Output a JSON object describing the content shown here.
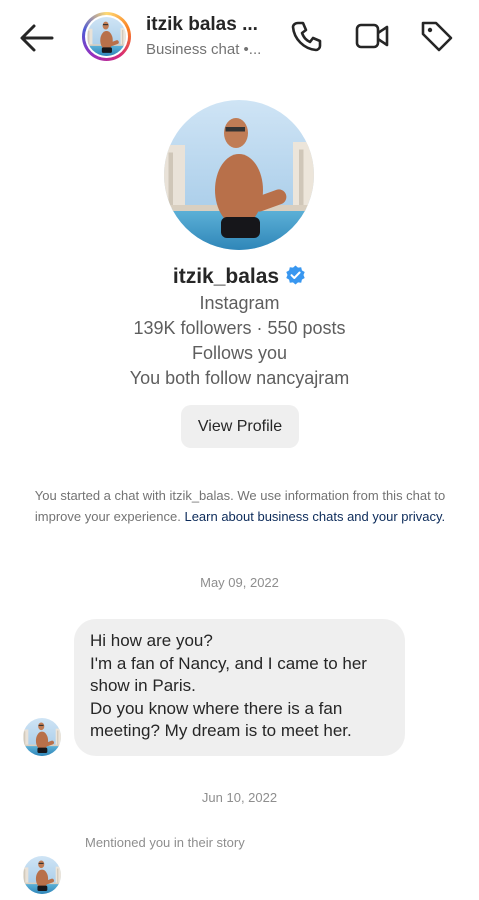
{
  "header": {
    "title": "itzik balas ...",
    "subtitle": "Business chat •...",
    "back_icon": "arrow-left-icon",
    "call_icon": "phone-icon",
    "video_icon": "video-camera-icon",
    "tag_icon": "tag-icon"
  },
  "profile": {
    "username": "itzik_balas",
    "verified_icon": "verified-badge-icon",
    "platform": "Instagram",
    "stats": "139K followers · 550 posts",
    "follows_you": "Follows you",
    "mutual": "You both follow nancyajram",
    "view_profile_label": "View Profile"
  },
  "notice": {
    "text": "You started a chat with itzik_balas. We use information from this chat to improve your experience.",
    "link": "Learn about business chats and your privacy."
  },
  "messages": {
    "date1": "May 09, 2022",
    "bubble_lines": [
      "Hi how are you?",
      "I'm a fan of Nancy, and I came to her",
      "show in Paris.",
      "Do you know where there is a fan",
      "meeting? My dream is to meet her."
    ],
    "date2": "Jun 10, 2022",
    "story_mention": "Mentioned you in their story"
  },
  "colors": {
    "accent_link": "#0c2b5a",
    "verified_blue": "#3897f0",
    "bubble_bg": "#efefef",
    "secondary_text": "#737373"
  }
}
